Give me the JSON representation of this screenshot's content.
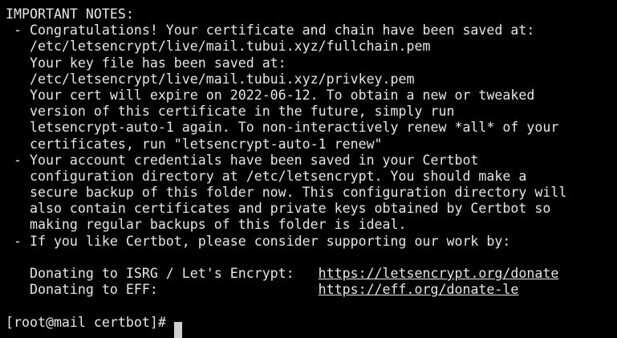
{
  "lines": [
    "IMPORTANT NOTES:",
    " - Congratulations! Your certificate and chain have been saved at:",
    "   /etc/letsencrypt/live/mail.tubui.xyz/fullchain.pem",
    "   Your key file has been saved at:",
    "   /etc/letsencrypt/live/mail.tubui.xyz/privkey.pem",
    "   Your cert will expire on 2022-06-12. To obtain a new or tweaked",
    "   version of this certificate in the future, simply run",
    "   letsencrypt-auto-1 again. To non-interactively renew *all* of your",
    "   certificates, run \"letsencrypt-auto-1 renew\"",
    " - Your account credentials have been saved in your Certbot",
    "   configuration directory at /etc/letsencrypt. You should make a",
    "   secure backup of this folder now. This configuration directory will",
    "   also contain certificates and private keys obtained by Certbot so",
    "   making regular backups of this folder is ideal.",
    " - If you like Certbot, please consider supporting our work by:",
    ""
  ],
  "donate": [
    {
      "label": "   Donating to ISRG / Let's Encrypt:   ",
      "url": "https://letsencrypt.org/donate"
    },
    {
      "label": "   Donating to EFF:                    ",
      "url": "https://eff.org/donate-le"
    }
  ],
  "prompt": "[root@mail certbot]# "
}
